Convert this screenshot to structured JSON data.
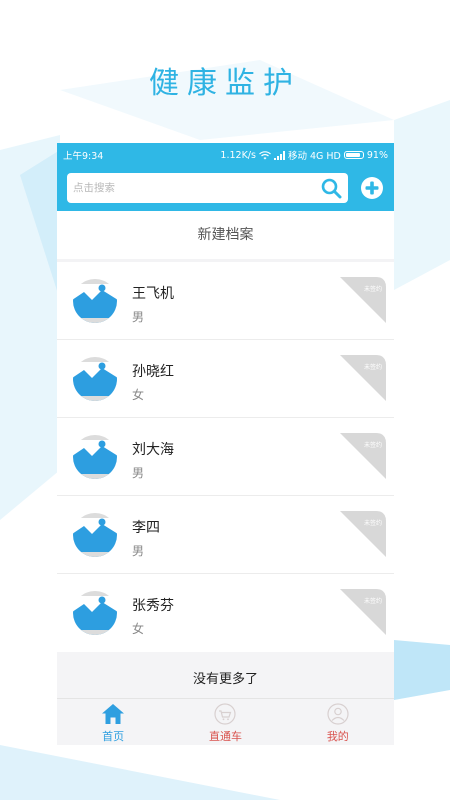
{
  "headline": "健康监护",
  "status_bar": {
    "time": "上午9:34",
    "speed": "1.12K/s",
    "carrier": "移动 4G HD",
    "battery_text": "91%",
    "battery_level": 0.91
  },
  "search": {
    "placeholder": "点击搜索"
  },
  "new_archive_label": "新建档案",
  "patients": [
    {
      "name": "王飞机",
      "gender": "男",
      "badge": "未签约"
    },
    {
      "name": "孙晓红",
      "gender": "女",
      "badge": "未签约"
    },
    {
      "name": "刘大海",
      "gender": "男",
      "badge": "未签约"
    },
    {
      "name": "李四",
      "gender": "男",
      "badge": "未签约"
    },
    {
      "name": "张秀芬",
      "gender": "女",
      "badge": "未签约"
    }
  ],
  "no_more_label": "没有更多了",
  "tabs": [
    {
      "label": "首页",
      "icon": "home-icon",
      "active": true
    },
    {
      "label": "直通车",
      "icon": "cart-icon",
      "active": false
    },
    {
      "label": "我的",
      "icon": "user-icon",
      "active": false
    }
  ],
  "colors": {
    "primary": "#2fb8e6",
    "active_tab": "#2f9fe0",
    "inactive_tab": "#d9534f",
    "badge": "#d8d8d8",
    "avatar": "#2d9ee0"
  }
}
